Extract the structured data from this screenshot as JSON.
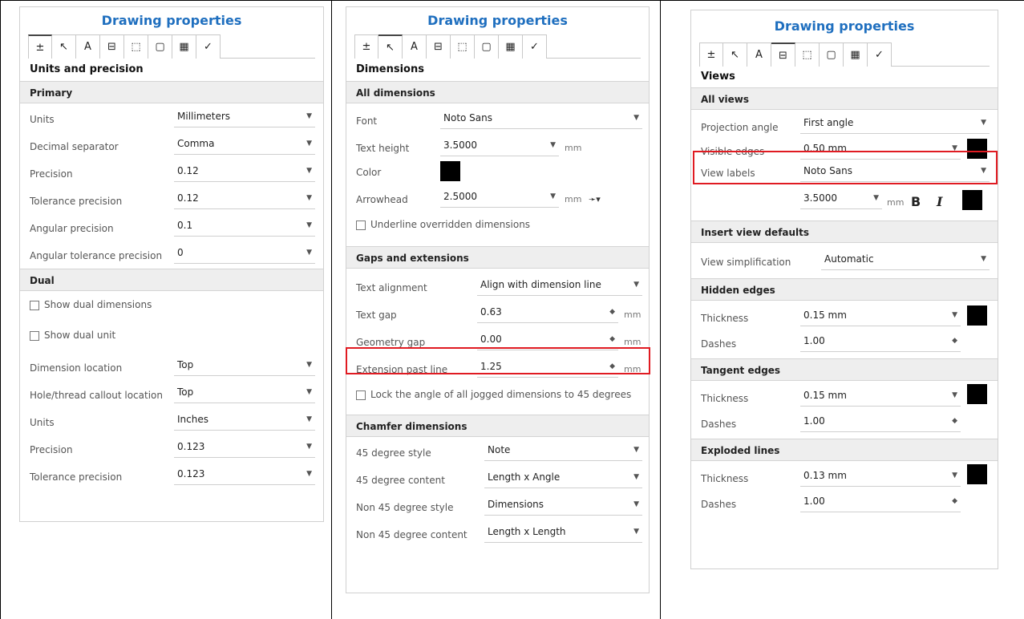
{
  "tabs": [
    {
      "icon": "units-icon",
      "glyph": "±"
    },
    {
      "icon": "arrow-dimension-icon",
      "glyph": "↖"
    },
    {
      "icon": "text-icon",
      "glyph": "A"
    },
    {
      "icon": "views-icon",
      "glyph": "⊟"
    },
    {
      "icon": "annotations-icon",
      "glyph": "⬚"
    },
    {
      "icon": "border-icon",
      "glyph": "▢"
    },
    {
      "icon": "table-icon",
      "glyph": "▦"
    },
    {
      "icon": "check-icon",
      "glyph": "✓"
    }
  ],
  "panel1": {
    "title": "Drawing properties",
    "section": "Units and precision",
    "primary_header": "Primary",
    "primary": [
      {
        "label": "Units",
        "value": "Millimeters"
      },
      {
        "label": "Decimal separator",
        "value": "Comma"
      },
      {
        "label": "Precision",
        "value": "0.12"
      },
      {
        "label": "Tolerance precision",
        "value": "0.12"
      },
      {
        "label": "Angular precision",
        "value": "0.1"
      },
      {
        "label": "Angular tolerance precision",
        "value": "0"
      }
    ],
    "dual_header": "Dual",
    "show_dual_dimensions": "Show dual dimensions",
    "show_dual_unit": "Show dual unit",
    "dual": [
      {
        "label": "Dimension location",
        "value": "Top"
      },
      {
        "label": "Hole/thread callout location",
        "value": "Top"
      },
      {
        "label": "Units",
        "value": "Inches"
      },
      {
        "label": "Precision",
        "value": "0.123"
      },
      {
        "label": "Tolerance precision",
        "value": "0.123"
      }
    ]
  },
  "panel2": {
    "title": "Drawing properties",
    "section": "Dimensions",
    "all_header": "All dimensions",
    "font_label": "Font",
    "font_value": "Noto Sans",
    "text_height_label": "Text height",
    "text_height_value": "3.5000",
    "text_height_unit": "mm",
    "color_label": "Color",
    "color_value": "#000000",
    "arrowhead_label": "Arrowhead",
    "arrowhead_value": "2.5000",
    "arrowhead_unit": "mm",
    "underline_label": "Underline overridden dimensions",
    "gaps_header": "Gaps and extensions",
    "text_alignment_label": "Text alignment",
    "text_alignment_value": "Align with dimension line",
    "text_gap_label": "Text gap",
    "text_gap_value": "0.63",
    "text_gap_unit": "mm",
    "geometry_gap_label": "Geometry gap",
    "geometry_gap_value": "0.00",
    "geometry_gap_unit": "mm",
    "ext_past_label": "Extension past line",
    "ext_past_value": "1.25",
    "ext_past_unit": "mm",
    "lock_angle_label": "Lock the angle of all jogged dimensions to 45 degrees",
    "chamfer_header": "Chamfer dimensions",
    "chamfer": [
      {
        "label": "45 degree style",
        "value": "Note"
      },
      {
        "label": "45 degree content",
        "value": "Length x Angle"
      },
      {
        "label": "Non 45 degree style",
        "value": "Dimensions"
      },
      {
        "label": "Non 45 degree content",
        "value": "Length x Length"
      }
    ]
  },
  "panel3": {
    "title": "Drawing properties",
    "section": "Views",
    "all_views_header": "All views",
    "projection_label": "Projection angle",
    "projection_value": "First angle",
    "visible_edges_label": "Visible edges",
    "visible_edges_value": "0.50 mm",
    "view_labels_label": "View labels",
    "view_labels_font": "Noto Sans",
    "view_labels_size": "3.5000",
    "view_labels_unit": "mm",
    "bold_glyph": "B",
    "italic_glyph": "I",
    "insert_header": "Insert view defaults",
    "simplification_label": "View simplification",
    "simplification_value": "Automatic",
    "hidden_header": "Hidden edges",
    "hidden_thickness_label": "Thickness",
    "hidden_thickness_value": "0.15 mm",
    "hidden_dashes_label": "Dashes",
    "hidden_dashes_value": "1.00",
    "tangent_header": "Tangent edges",
    "tangent_thickness_label": "Thickness",
    "tangent_thickness_value": "0.15 mm",
    "tangent_dashes_label": "Dashes",
    "tangent_dashes_value": "1.00",
    "exploded_header": "Exploded lines",
    "exploded_thickness_label": "Thickness",
    "exploded_thickness_value": "0.13 mm",
    "exploded_dashes_label": "Dashes",
    "exploded_dashes_value": "1.00"
  },
  "colors": {
    "accent": "#1f6fbf",
    "highlight": "#e01b22",
    "swatch": "#000000"
  }
}
